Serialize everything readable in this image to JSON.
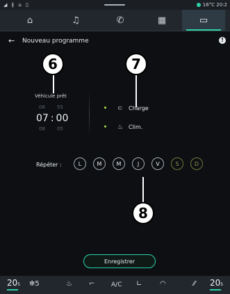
{
  "status_bar": {
    "left_icons": "◢ ∦ ⌂ ▯",
    "temperature": "16°C",
    "time": "20:2"
  },
  "nav": {
    "tabs": [
      {
        "icon": "home-icon",
        "glyph": "⌂"
      },
      {
        "icon": "music-icon",
        "glyph": "♫"
      },
      {
        "icon": "phone-icon",
        "glyph": "✆"
      },
      {
        "icon": "apps-grid-icon",
        "glyph": "▦"
      },
      {
        "icon": "vehicle-icon",
        "glyph": "▭"
      }
    ]
  },
  "header": {
    "back": "←",
    "title": "Nouveau programme",
    "info": "!"
  },
  "callouts": {
    "six": "6",
    "seven": "7",
    "eight": "8"
  },
  "program": {
    "vehicle_label": "Véhicule prêt",
    "time_above": {
      "hour": "06",
      "minute": "55"
    },
    "time_current": {
      "hour": "07",
      "sep": ":",
      "minute": "00"
    },
    "time_below": {
      "hour": "08",
      "minute": "05"
    },
    "options": [
      {
        "label": "Charge",
        "icon": "charge-icon",
        "glyph": "⊂"
      },
      {
        "label": "Clim.",
        "icon": "climate-icon",
        "glyph": "♨"
      }
    ],
    "repeat_label": "Répéter :",
    "days": [
      "L",
      "M",
      "M",
      "J",
      "V",
      "S",
      "D"
    ]
  },
  "save_label": "Enregistrer",
  "bottom_bar": {
    "left_temp": "20",
    "left_temp_unit": "5",
    "fan": "5",
    "ac": "A/C",
    "right_temp": "20",
    "right_temp_unit": "5"
  },
  "colors": {
    "accent": "#2bd0a8",
    "option_dot": "#b5e24a",
    "weekend": "#6d7b3a"
  }
}
